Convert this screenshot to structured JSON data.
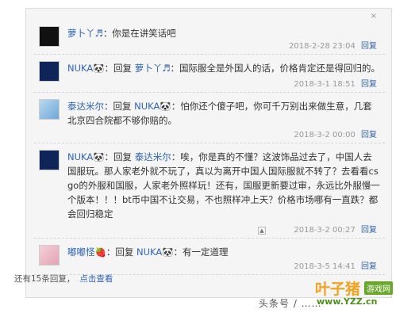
{
  "close_label": "×",
  "replies": [
    {
      "user": "萝卜丫♬",
      "text": "：你是在讲笑话吧",
      "time": "2018-2-28 23:04",
      "reply_label": "回复"
    },
    {
      "user": "NUKA🐼",
      "reply_prefix": "：回复",
      "target": "萝卜丫♬",
      "text": "：国际服全是外国人的话，价格肯定还是得回归的。",
      "time": "2018-3-1 18:51",
      "reply_label": "回复"
    },
    {
      "user": "泰达米尔",
      "reply_prefix": "：回复",
      "target": "NUKA🐼",
      "text": "：怕你还个傻子吧，你可千万别出来做生意，几套北京四合院都不够你赔的。",
      "time": "2018-3-2 00:00",
      "reply_label": "回复"
    },
    {
      "user": "NUKA🐼",
      "reply_prefix": "：回复",
      "target": "泰达米尔",
      "text": "：唉，你是真的不懂？这波饰品过去了，中国人去国服玩。那人家老外就不玩了，真以为离开中国人国际服就不转了？去看看csgo的外服和国服，人家老外照样玩！还有，国服更新要过审，永远比外服慢一个版本！！！bt币中国不让交易，不也照样冲上天？价格市场哪有一直跌？都会回归稳定",
      "time": "2018-3-2 00:27",
      "reply_label": "回复",
      "flag": "▲"
    },
    {
      "user": "嘟嘟怪🍓",
      "reply_prefix": "：回复",
      "target": "NUKA🐼",
      "text": "：有一定道理",
      "time": "2018-3-5 14:41",
      "reply_label": "回复"
    }
  ],
  "footer": {
    "count_text": "还有15条回复，",
    "view_label": "点击查看"
  },
  "watermark": "头条号 / ……",
  "logo": {
    "main": "叶子猪",
    "badge": "游戏网",
    "url": "www.YZZ.cn"
  }
}
